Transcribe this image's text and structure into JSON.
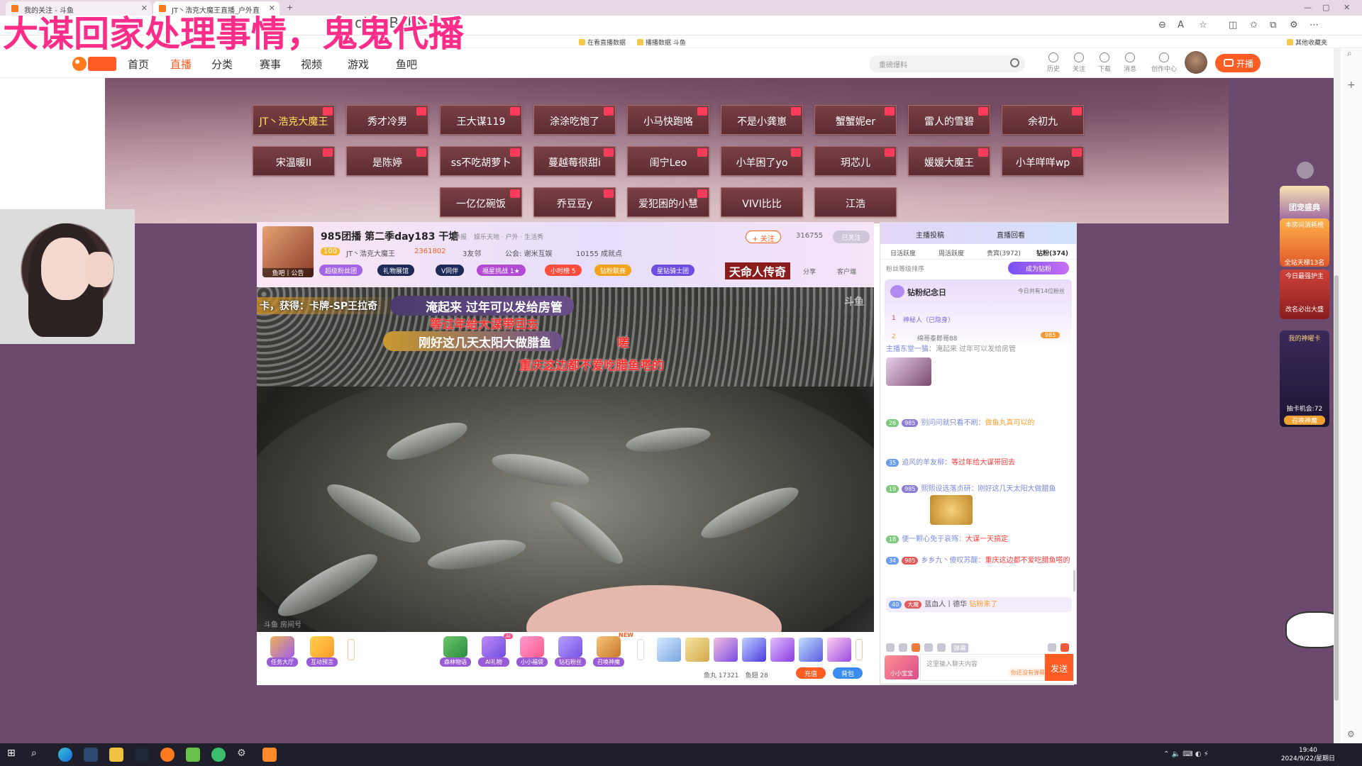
{
  "overlay": {
    "title": "大谋回家处理事情，鬼鬼代播",
    "background_text": "took y Baby m"
  },
  "browser": {
    "tabs": [
      {
        "label": "我的关注 - 斗鱼"
      },
      {
        "label": "JT丶浩克大魔王直播_户外直"
      }
    ],
    "bookmarks": [
      "在看直播数据",
      "播播数据 斗鱼",
      "其他收藏夹"
    ],
    "colors": {
      "tab_bg": "#e8d8e6"
    }
  },
  "site": {
    "logo_text": "斗鱼",
    "nav": [
      "首页",
      "直播",
      "分类",
      "赛事",
      "视频",
      "游戏",
      "鱼吧"
    ],
    "active_nav": "直播",
    "search_placeholder": "重磅爆料",
    "header_icons": [
      "历史",
      "关注",
      "下载",
      "消息",
      "创作中心"
    ],
    "open_button": "开播",
    "accent": "#ff5d23"
  },
  "streamers": {
    "row1": [
      "JT丶浩克大魔王",
      "秀才冷男",
      "王大谋119",
      "涂涂吃饱了",
      "小马快跑咯",
      "不是小龚崽",
      "蟹蟹妮er",
      "雷人的雪碧",
      "余初九"
    ],
    "row2": [
      "宋温暖II",
      "是陈婷",
      "ss不吃胡萝卜",
      "蔓越莓很甜i",
      "闺宁Leo",
      "小羊困了yo",
      "玥芯儿",
      "媛媛大魔王",
      "小羊咩咩wp"
    ],
    "row3": [
      "一亿亿碗饭",
      "乔豆豆y",
      "爱犯困的小慧",
      "VIVI比比",
      "江浩"
    ]
  },
  "room": {
    "title": "985团播 第二季day183 干塘",
    "report": "举报",
    "category": "娱乐天地 · 户外 · 生活秀",
    "follow_label": "+ 关注",
    "follow_count": "316755",
    "followed_label": "已关注",
    "avatar_caption": "鱼吧丨公告",
    "level": "100",
    "anchor": "JT丶浩克大魔王",
    "hot": "2361802",
    "friends": "3友邻",
    "union": "公会: 谢米互娱",
    "power": "10155 成就点",
    "pills": [
      "超级粉丝团",
      "礼物展馆",
      "V同伴",
      "福星挑战 1★",
      "小时榜 5",
      "钻粉联赛",
      "星钻骑士团"
    ],
    "banner_tag": "天命人传奇",
    "share": "分享",
    "client": "客户端"
  },
  "video": {
    "danmaku": [
      {
        "text": "卡，获得：卡牌-SP王拉奇",
        "style": "white"
      },
      {
        "text": "淹起来 过年可以发给房管",
        "style": "badge"
      },
      {
        "text": "等过年给大谋带回去",
        "style": "red"
      },
      {
        "text": "刚好这几天太阳大做腊鱼",
        "style": "badge"
      },
      {
        "text": "嗟",
        "style": "red"
      },
      {
        "text": "重庆这边都不爱吃腊鱼嗒的",
        "style": "red"
      }
    ],
    "logo": "斗鱼",
    "room_tag": "斗鱼 房间号"
  },
  "gifts": {
    "left": [
      "任务大厅",
      "互动预言"
    ],
    "center": [
      "森林物语",
      "AI礼物",
      "小小福袋",
      "钻石粉丝",
      "召唤神魔"
    ],
    "new_badge": "NEW",
    "ai_badge": "AI",
    "fish_balls": "鱼丸 17321",
    "fish_coins": "鱼翅 28",
    "recharge": "充值",
    "bag": "背包"
  },
  "chat": {
    "head": [
      "主播投稿",
      "直播回看"
    ],
    "tabs": [
      "日活跃度",
      "周活跃度",
      "贵宾(3972)",
      "钻粉(374)"
    ],
    "fan_sort": "粉丝等级排序",
    "become_fan": "成为钻粉",
    "anniversary_title": "钻粉纪念日",
    "anniversary_sub": "今日共有14位粉丝",
    "rank": [
      {
        "no": "1",
        "name": "神秘人（已隐身）"
      },
      {
        "no": "2",
        "name": "绵哥泰郎哥88",
        "badge": "985"
      }
    ],
    "messages": [
      {
        "user": "主播东堂一猫：",
        "text": "淹起来 过年可以发给房管"
      },
      {
        "level": "26",
        "fan": "985",
        "user": "别问问就只看不刷：",
        "text": "做鱼丸真可以的"
      },
      {
        "level": "35",
        "user": "追风的羊友柳：",
        "text": "等过年给大谋带回去"
      },
      {
        "level": "19",
        "fan": "985",
        "user": "熙熙设选落贞研：",
        "text": "刚好这几天太阳大做腊鱼"
      },
      {
        "level": "18",
        "user": "便一颗心免于哀殇：",
        "text": "大谋一天搞定"
      },
      {
        "level": "34",
        "fan": "985",
        "user": "乡乡九丶傻叹苏醒：",
        "text": "重庆这边都不爱吃腊鱼嗒的"
      },
      {
        "level": "40",
        "fan": "大魔",
        "user": "蓝血人丨德华",
        "text": "钻粉来了"
      }
    ],
    "tool_label": "弹幕",
    "fan_badge": "小小宝宝",
    "input_placeholder": "这里输入聊天内容",
    "unlock": "你还没有弹幕特权",
    "send": "发送"
  },
  "right_floats": [
    "团宠盛典",
    "本房间消耗榜",
    "全站天梯13名",
    "今日最强护主",
    "改名必出大盛",
    "我的神曜卡",
    "抽卡机会:72",
    "召唤神魔"
  ],
  "taskbar": {
    "time": "19:40",
    "date": "2024/9/22/星期日"
  }
}
